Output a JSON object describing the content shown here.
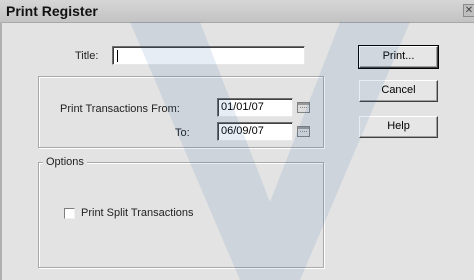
{
  "window": {
    "title": "Print Register",
    "close_glyph": "✕"
  },
  "form": {
    "title_label": "Title:",
    "title_value": "",
    "dates": {
      "from_label": "Print Transactions From:",
      "from_value": "01/01/07",
      "to_label": "To:",
      "to_value": "06/09/07"
    },
    "options": {
      "legend": "Options",
      "split_label": "Print Split Transactions",
      "split_checked": false
    }
  },
  "buttons": {
    "print": "Print...",
    "cancel": "Cancel",
    "help": "Help"
  }
}
